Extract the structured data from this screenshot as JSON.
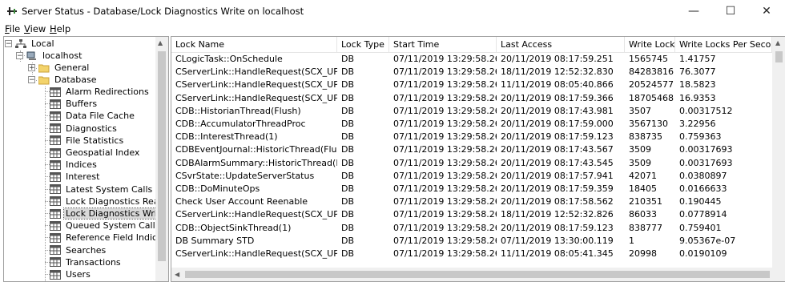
{
  "window": {
    "title": "Server Status - Database/Lock Diagnostics Write on localhost",
    "minimize_glyph": "—",
    "maximize_glyph": "☐",
    "close_glyph": "✕"
  },
  "menu": {
    "file": {
      "mnemonic": "F",
      "rest": "ile"
    },
    "view": {
      "mnemonic": "V",
      "rest": "iew"
    },
    "help": {
      "mnemonic": "H",
      "rest": "elp"
    }
  },
  "tree": {
    "root": "Local",
    "server": "localhost",
    "general": "General",
    "database": "Database",
    "items": [
      "Alarm Redirections",
      "Buffers",
      "Data File Cache",
      "Diagnostics",
      "File Statistics",
      "Geospatial Index",
      "Indices",
      "Interest",
      "Latest System Calls",
      "Lock Diagnostics Read",
      "Lock Diagnostics Write",
      "Queued System Calls",
      "Reference Field Indices",
      "Searches",
      "Transactions",
      "Users"
    ],
    "selected": "Lock Diagnostics Write"
  },
  "grid": {
    "columns": [
      "Lock Name",
      "Lock Type",
      "Start Time",
      "Last Access",
      "Write Locks",
      "Write Locks Per Second"
    ],
    "rows": [
      [
        "CLogicTask::OnSchedule",
        "DB",
        "07/11/2019 13:29:58.262",
        "20/11/2019 08:17:59.251",
        "1565745",
        "1.41757"
      ],
      [
        "CServerLink::HandleRequest(SCX_UPDATE_...",
        "DB",
        "07/11/2019 13:29:58.262",
        "18/11/2019 12:52:32.830",
        "84283816",
        "76.3077"
      ],
      [
        "CServerLink::HandleRequest(SCX_UPDATE_...",
        "DB",
        "07/11/2019 13:29:58.262",
        "11/11/2019 08:05:40.866",
        "20524577",
        "18.5823"
      ],
      [
        "CServerLink::HandleRequest(SCX_UPDATE_...",
        "DB",
        "07/11/2019 13:29:58.262",
        "20/11/2019 08:17:59.366",
        "18705468",
        "16.9353"
      ],
      [
        "CDB::HistorianThread(Flush)",
        "DB",
        "07/11/2019 13:29:58.262",
        "20/11/2019 08:17:43.981",
        "3507",
        "0.00317512"
      ],
      [
        "CDB::AccumulatorThreadProc",
        "DB",
        "07/11/2019 13:29:58.262",
        "20/11/2019 08:17:59.000",
        "3567130",
        "3.22956"
      ],
      [
        "CDB::InterestThread(1)",
        "DB",
        "07/11/2019 13:29:58.262",
        "20/11/2019 08:17:59.123",
        "838735",
        "0.759363"
      ],
      [
        "CDBEventJournal::HistoricThread(Flush)",
        "DB",
        "07/11/2019 13:29:58.262",
        "20/11/2019 08:17:43.567",
        "3509",
        "0.00317693"
      ],
      [
        "CDBAlarmSummary::HistoricThread(Flush)",
        "DB",
        "07/11/2019 13:29:58.262",
        "20/11/2019 08:17:43.545",
        "3509",
        "0.00317693"
      ],
      [
        "CSvrState::UpdateServerStatus",
        "DB",
        "07/11/2019 13:29:58.262",
        "20/11/2019 08:17:57.941",
        "42071",
        "0.0380897"
      ],
      [
        "CDB::DoMinuteOps",
        "DB",
        "07/11/2019 13:29:58.262",
        "20/11/2019 08:17:59.359",
        "18405",
        "0.0166633"
      ],
      [
        "Check User Account Reenable",
        "DB",
        "07/11/2019 13:29:58.262",
        "20/11/2019 08:17:58.562",
        "210351",
        "0.190445"
      ],
      [
        "CServerLink::HandleRequest(SCX_UPDATE_...",
        "DB",
        "07/11/2019 13:29:58.262",
        "18/11/2019 12:52:32.826",
        "86033",
        "0.0778914"
      ],
      [
        "CDB::ObjectSinkThread(1)",
        "DB",
        "07/11/2019 13:29:58.262",
        "20/11/2019 08:17:59.123",
        "838777",
        "0.759401"
      ],
      [
        "DB Summary STD",
        "DB",
        "07/11/2019 13:29:58.262",
        "07/11/2019 13:30:00.119",
        "1",
        "9.05367e-07"
      ],
      [
        "CServerLink::HandleRequest(SCX_UPDATE_...",
        "DB",
        "07/11/2019 13:29:58.262",
        "11/11/2019 08:05:41.345",
        "20998",
        "0.0190109"
      ]
    ]
  },
  "colors": {
    "selection": "#d9d9d9",
    "border": "#a0a0a0",
    "scroll_track": "#f0f0f0",
    "scroll_thumb": "#c8c8c8"
  },
  "icons": [
    "server-status-icon",
    "network-icon",
    "computer-icon",
    "folder-icon",
    "table-icon"
  ]
}
